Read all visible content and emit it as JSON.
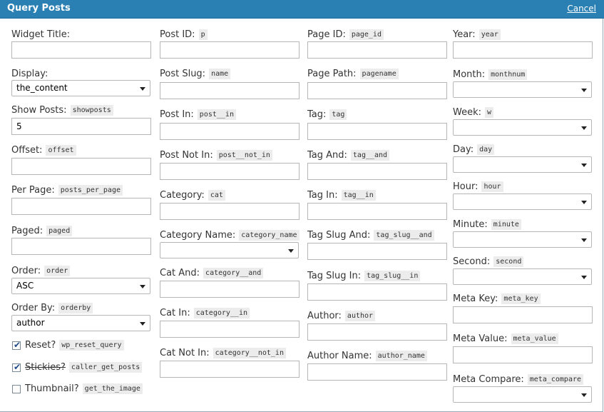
{
  "header": {
    "title": "Query Posts",
    "cancel_label": "Cancel"
  },
  "col1": {
    "widget_title": {
      "label": "Widget Title:",
      "value": ""
    },
    "display": {
      "label": "Display:",
      "value": "the_content"
    },
    "show_posts": {
      "label": "Show Posts:",
      "code": "showposts",
      "value": "5"
    },
    "offset": {
      "label": "Offset:",
      "code": "offset",
      "value": ""
    },
    "per_page": {
      "label": "Per Page:",
      "code": "posts_per_page",
      "value": ""
    },
    "paged": {
      "label": "Paged:",
      "code": "paged",
      "value": ""
    },
    "order": {
      "label": "Order:",
      "code": "order",
      "value": "ASC"
    },
    "order_by": {
      "label": "Order By:",
      "code": "orderby",
      "value": "author"
    },
    "reset": {
      "label": "Reset?",
      "code": "wp_reset_query",
      "checked": true
    },
    "stickies": {
      "label": "Stickies?",
      "code": "caller_get_posts",
      "checked": true
    },
    "thumbnail": {
      "label": "Thumbnail?",
      "code": "get_the_image",
      "checked": false
    }
  },
  "col2": {
    "post_id": {
      "label": "Post ID:",
      "code": "p",
      "value": ""
    },
    "post_slug": {
      "label": "Post Slug:",
      "code": "name",
      "value": ""
    },
    "post_in": {
      "label": "Post In:",
      "code": "post__in",
      "value": ""
    },
    "post_not_in": {
      "label": "Post Not In:",
      "code": "post__not_in",
      "value": ""
    },
    "category": {
      "label": "Category:",
      "code": "cat",
      "value": ""
    },
    "category_name": {
      "label": "Category Name:",
      "code": "category_name",
      "value": ""
    },
    "cat_and": {
      "label": "Cat And:",
      "code": "category__and",
      "value": ""
    },
    "cat_in": {
      "label": "Cat In:",
      "code": "category__in",
      "value": ""
    },
    "cat_not_in": {
      "label": "Cat Not In:",
      "code": "category__not_in",
      "value": ""
    }
  },
  "col3": {
    "page_id": {
      "label": "Page ID:",
      "code": "page_id",
      "value": ""
    },
    "page_path": {
      "label": "Page Path:",
      "code": "pagename",
      "value": ""
    },
    "tag": {
      "label": "Tag:",
      "code": "tag",
      "value": ""
    },
    "tag_and": {
      "label": "Tag And:",
      "code": "tag__and",
      "value": ""
    },
    "tag_in": {
      "label": "Tag In:",
      "code": "tag__in",
      "value": ""
    },
    "tag_slug_and": {
      "label": "Tag Slug And:",
      "code": "tag_slug__and",
      "value": ""
    },
    "tag_slug_in": {
      "label": "Tag Slug In:",
      "code": "tag_slug__in",
      "value": ""
    },
    "author": {
      "label": "Author:",
      "code": "author",
      "value": ""
    },
    "author_name": {
      "label": "Author Name:",
      "code": "author_name",
      "value": ""
    }
  },
  "col4": {
    "year": {
      "label": "Year:",
      "code": "year",
      "value": ""
    },
    "month": {
      "label": "Month:",
      "code": "monthnum",
      "value": ""
    },
    "week": {
      "label": "Week:",
      "code": "w",
      "value": ""
    },
    "day": {
      "label": "Day:",
      "code": "day",
      "value": ""
    },
    "hour": {
      "label": "Hour:",
      "code": "hour",
      "value": ""
    },
    "minute": {
      "label": "Minute:",
      "code": "minute",
      "value": ""
    },
    "second": {
      "label": "Second:",
      "code": "second",
      "value": ""
    },
    "meta_key": {
      "label": "Meta Key:",
      "code": "meta_key",
      "value": ""
    },
    "meta_value": {
      "label": "Meta Value:",
      "code": "meta_value",
      "value": ""
    },
    "meta_compare": {
      "label": "Meta Compare:",
      "code": "meta_compare",
      "value": ""
    }
  },
  "colors": {
    "header_bg": "#2a7fb3",
    "check_mark": "#1d4a8a",
    "code_bg": "#ececec"
  }
}
